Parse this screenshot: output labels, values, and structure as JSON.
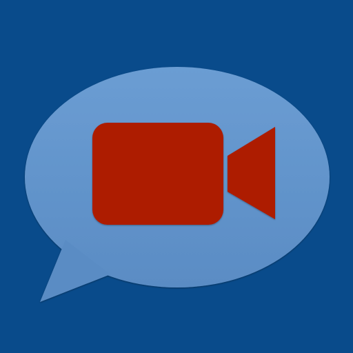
{
  "icon": {
    "background_color": "#094b8b",
    "bubble_icon": "speech-bubble-icon",
    "bubble_color": "#6092c9",
    "bubble_edge_color": "#4d7db7",
    "camera_icon": "video-camera-icon",
    "camera_color": "#ad1a05",
    "camera_edge_color": "#8e1402"
  }
}
